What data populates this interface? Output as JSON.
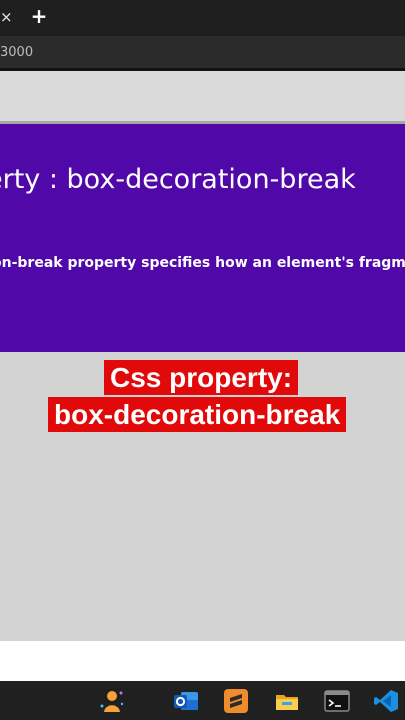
{
  "browser": {
    "tab_close_glyph": "×",
    "new_tab_glyph": "+",
    "url_text": "3000"
  },
  "page": {
    "heading": "erty : box-decoration-break",
    "description": "on-break property specifies how an element's fragmen"
  },
  "caption": {
    "line1": "Css property:",
    "line2": "box-decoration-break"
  },
  "colors": {
    "banner": "#5009a8",
    "caption_bg": "#e10909",
    "taskbar": "#202020"
  },
  "taskbar": {
    "icons": [
      "copilot-icon",
      "outlook-icon",
      "sublime-text-icon",
      "file-explorer-icon",
      "terminal-icon",
      "vscode-icon"
    ]
  }
}
